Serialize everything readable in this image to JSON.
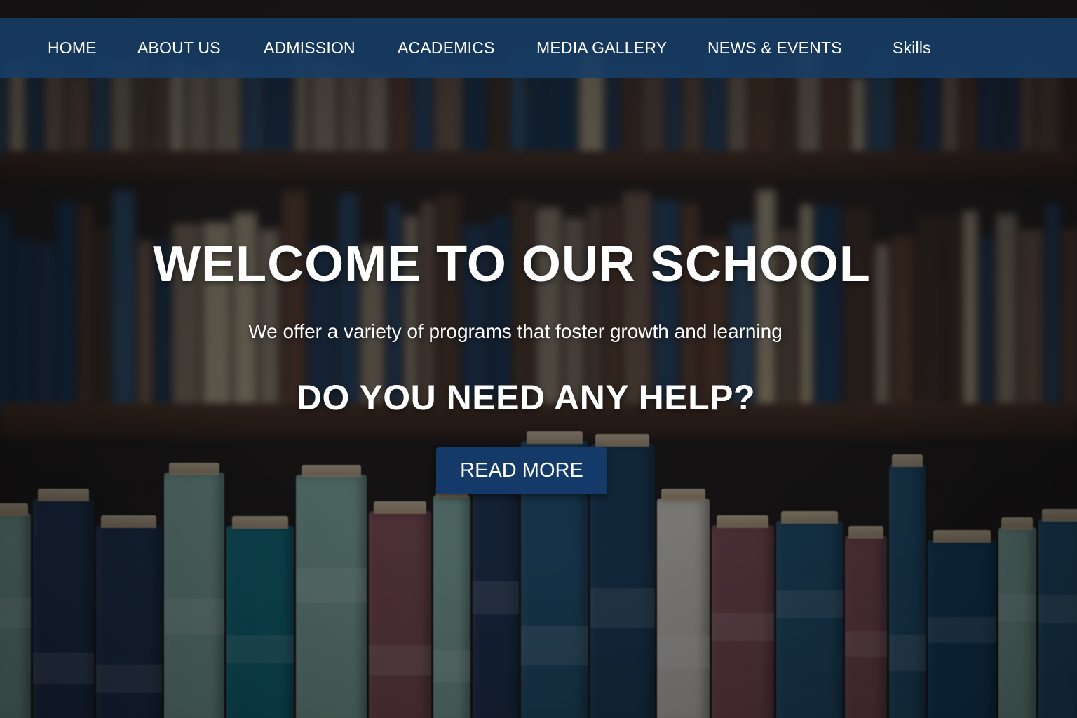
{
  "nav": {
    "items": [
      {
        "label": "HOME"
      },
      {
        "label": "ABOUT US"
      },
      {
        "label": "ADMISSION"
      },
      {
        "label": "ACADEMICS"
      },
      {
        "label": "MEDIA GALLERY"
      },
      {
        "label": "NEWS & EVENTS"
      },
      {
        "label": "Skills"
      }
    ]
  },
  "hero": {
    "title": "WELCOME TO OUR SCHOOL",
    "subtitle": "We offer a variety of programs that foster growth and learning",
    "help_heading": "DO YOU NEED ANY HELP?",
    "button_label": "READ MORE"
  },
  "colors": {
    "nav_background": "#173e66",
    "button_background": "#133a68",
    "text": "#ffffff"
  }
}
